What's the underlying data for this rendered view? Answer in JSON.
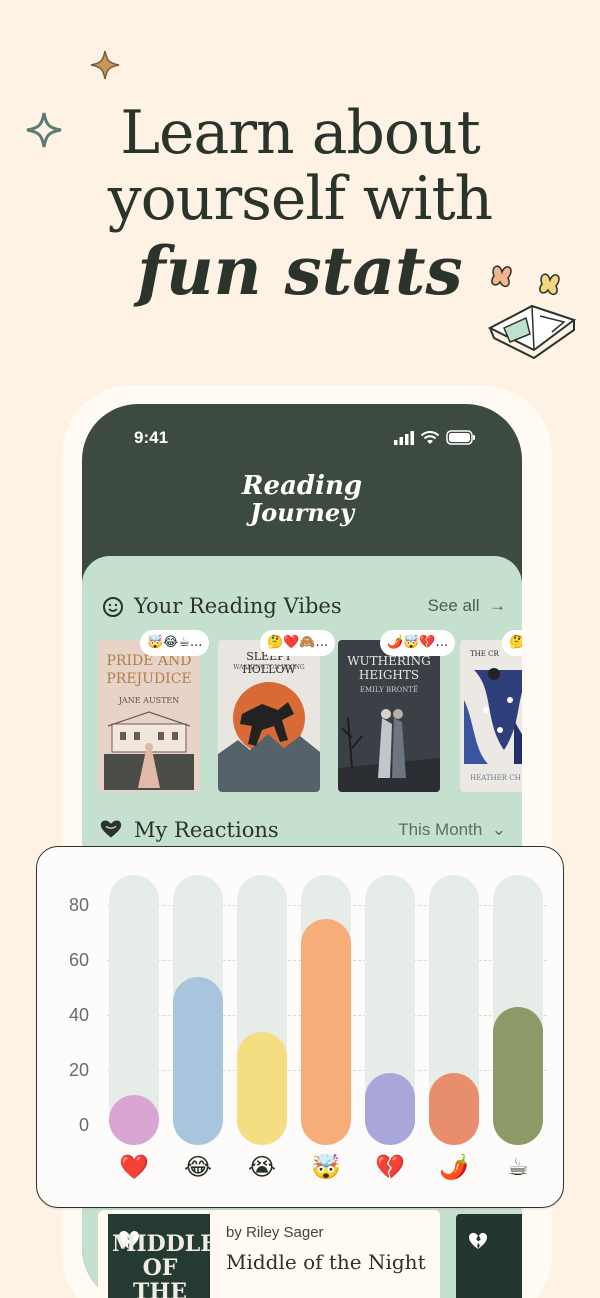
{
  "headline": {
    "line1": "Learn about",
    "line2": "yourself with",
    "line3": "fun stats"
  },
  "status": {
    "time": "9:41"
  },
  "logo": {
    "line1": "Reading",
    "line2": "Journey"
  },
  "vibes": {
    "title": "Your Reading Vibes",
    "see_all": "See all",
    "books": [
      {
        "title": "PRIDE AND PREJUDICE",
        "author": "JANE AUSTEN",
        "emojis": "🤯😂☕...",
        "bg": "#e8d3c9"
      },
      {
        "title": "SLEEPY HOLLOW",
        "author": "WASHINGTON IRVING",
        "emojis": "🤔❤️🙈...",
        "bg": "#e9e6e2"
      },
      {
        "title": "WUTHERING HEIGHTS",
        "author": "EMILY BRONTË",
        "emojis": "🌶️🤯💔...",
        "bg": "#3b4046"
      },
      {
        "title": "THE CR",
        "author": "HEATHER CH",
        "emojis": "🤔",
        "bg": "#ece8e3"
      }
    ]
  },
  "reactions": {
    "title": "My Reactions",
    "period": "This Month"
  },
  "chart_data": {
    "type": "bar",
    "categories": [
      "❤️",
      "😂",
      "😭",
      "🤯",
      "💔",
      "🌶️",
      "☕"
    ],
    "values": [
      16,
      61,
      41,
      82,
      26,
      26,
      50
    ],
    "colors": [
      "#d9a5d1",
      "#a9c5de",
      "#f5dd82",
      "#f6ad78",
      "#a9a6d9",
      "#e98d6f",
      "#8e9968"
    ],
    "yticks": [
      "0",
      "20",
      "40",
      "60",
      "80"
    ],
    "ylim": [
      0,
      98
    ],
    "grid": true
  },
  "current_book": {
    "author": "by Riley Sager",
    "title": "Middle of the Night",
    "cover_text": "MIDDLE OF THE NIGHT"
  }
}
